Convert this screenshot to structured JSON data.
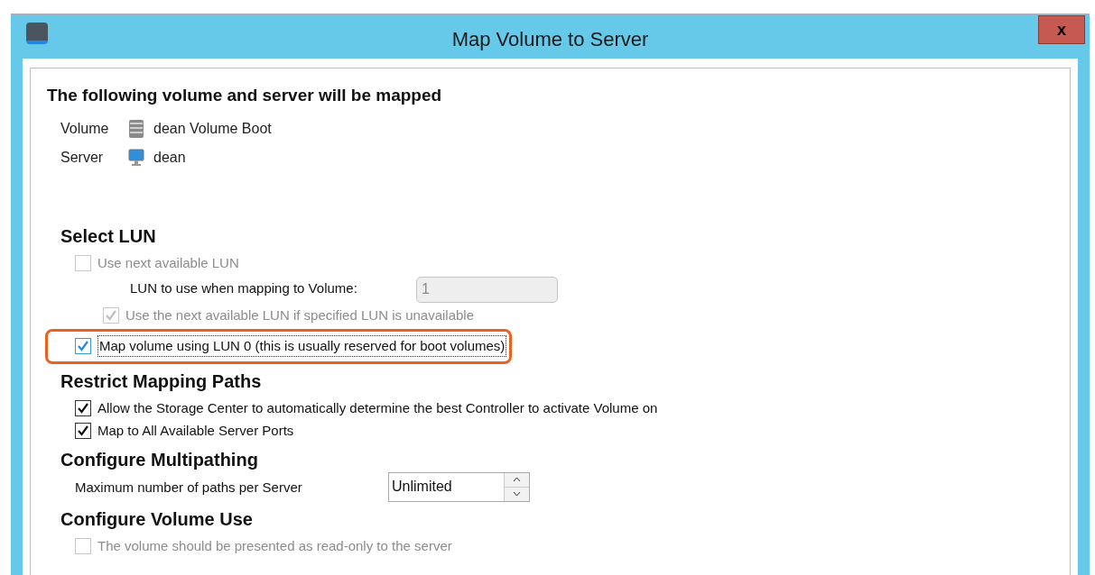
{
  "window": {
    "title": "Map Volume to Server",
    "close_label": "x"
  },
  "summary": {
    "heading": "The following volume and server will be mapped",
    "rows": [
      {
        "kind": "volume",
        "label": "Volume",
        "value": "dean Volume Boot"
      },
      {
        "kind": "server",
        "label": "Server",
        "value": "dean"
      }
    ]
  },
  "sections": [
    {
      "heading": "Select LUN",
      "items": [
        {
          "kind": "checkbox",
          "label": "Use next available LUN",
          "checked": false,
          "disabled": true,
          "highlighted": false,
          "children": [
            {
              "kind": "field",
              "label": "LUN to use when mapping to Volume:",
              "value": "1",
              "disabled": true
            },
            {
              "kind": "checkbox",
              "label": "Use the next available LUN if specified LUN is unavailable",
              "checked": true,
              "disabled": true,
              "highlighted": false
            }
          ]
        },
        {
          "kind": "checkbox",
          "label": "Map volume using LUN 0 (this is usually reserved for boot volumes)",
          "checked": true,
          "disabled": false,
          "highlighted": true
        }
      ]
    },
    {
      "heading": "Restrict Mapping Paths",
      "items": [
        {
          "kind": "checkbox",
          "label": "Allow the Storage Center to automatically determine the best Controller to activate Volume on",
          "checked": true,
          "disabled": false,
          "highlighted": false
        },
        {
          "kind": "checkbox",
          "label": "Map to All Available Server Ports",
          "checked": true,
          "disabled": false,
          "highlighted": false
        }
      ]
    },
    {
      "heading": "Configure Multipathing",
      "items": [
        {
          "kind": "spinner",
          "label": "Maximum number of paths per Server",
          "value": "Unlimited"
        }
      ]
    },
    {
      "heading": "Configure Volume Use",
      "items": [
        {
          "kind": "checkbox",
          "label": "The volume should be presented as read-only to the server",
          "checked": false,
          "disabled": true,
          "highlighted": false
        }
      ]
    }
  ]
}
